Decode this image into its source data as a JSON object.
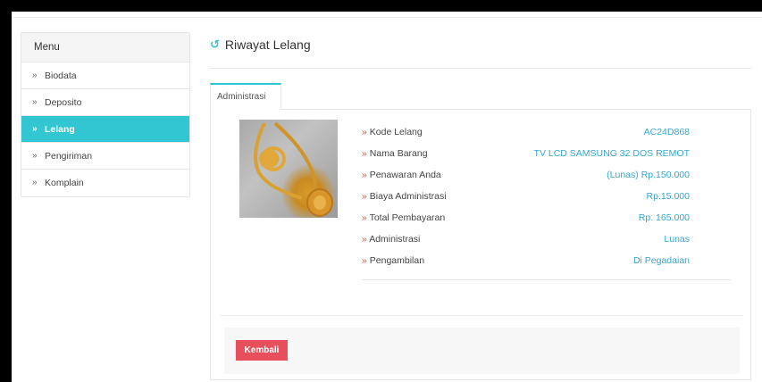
{
  "sidebar": {
    "header": "Menu",
    "items": [
      {
        "label": "Biodata",
        "active": false
      },
      {
        "label": "Deposito",
        "active": false
      },
      {
        "label": "Lelang",
        "active": true
      },
      {
        "label": "Pengiriman",
        "active": false
      },
      {
        "label": "Komplain",
        "active": false
      }
    ],
    "chevron": "»"
  },
  "main": {
    "title": "Riwayat Lelang",
    "title_icon": "history-icon",
    "tabs": [
      {
        "label": "Administrasi"
      }
    ],
    "item_image": "gold-necklace-image",
    "details": [
      {
        "label": "Kode Lelang",
        "value": "AC24D868"
      },
      {
        "label": "Nama Barang",
        "value": "TV LCD SAMSUNG 32 DOS REMOT"
      },
      {
        "label": "Penawaran Anda",
        "value": "(Lunas) Rp.150.000"
      },
      {
        "label": "Biaya Administrasi",
        "value": "Rp.15.000"
      },
      {
        "label": "Total Pembayaran",
        "value": "Rp. 165.000"
      },
      {
        "label": "Administrasi",
        "value": "Lunas"
      },
      {
        "label": "Pengambilan",
        "value": "Di Pegadaian"
      }
    ],
    "back_label": "Kembali"
  },
  "colors": {
    "accent": "#32c5d2",
    "value_text": "#32a7d2",
    "danger": "#e7505a"
  }
}
